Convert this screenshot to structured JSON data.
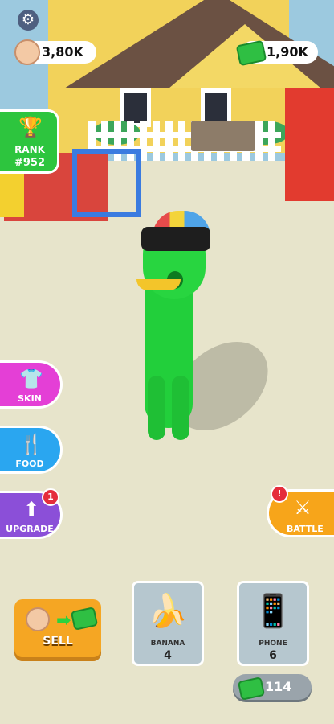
{
  "hud": {
    "settings_icon": "gear-icon",
    "followers": {
      "icon": "sumo-head-icon",
      "value": "3,80K"
    },
    "money": {
      "icon": "cash-icon",
      "value": "1,90K"
    }
  },
  "rank": {
    "label": "RANK",
    "value": "#952",
    "icon": "trophy-icon",
    "color": "#2dc53e"
  },
  "side_buttons": [
    {
      "label": "SKIN",
      "icon": "shirt-icon",
      "color": "#e43fd6"
    },
    {
      "label": "FOOD",
      "icon": "fork-knife-icon",
      "color": "#2aa6f0"
    },
    {
      "label": "UPGRADE",
      "icon": "arrow-up-icon",
      "color": "#8b4fd8",
      "badge": "1"
    }
  ],
  "battle": {
    "label": "BATTLE",
    "icon": "crossed-swords-icon",
    "badge": "!",
    "color": "#f7a51a"
  },
  "sell": {
    "label": "SELL",
    "icon": "sumo-to-cash-icon"
  },
  "items": [
    {
      "name": "BANANA",
      "count": "4",
      "icon": "banana-icon"
    },
    {
      "name": "PHONE",
      "count": "6",
      "icon": "phone-icon"
    }
  ],
  "cost": {
    "value": "114",
    "icon": "cash-icon"
  }
}
